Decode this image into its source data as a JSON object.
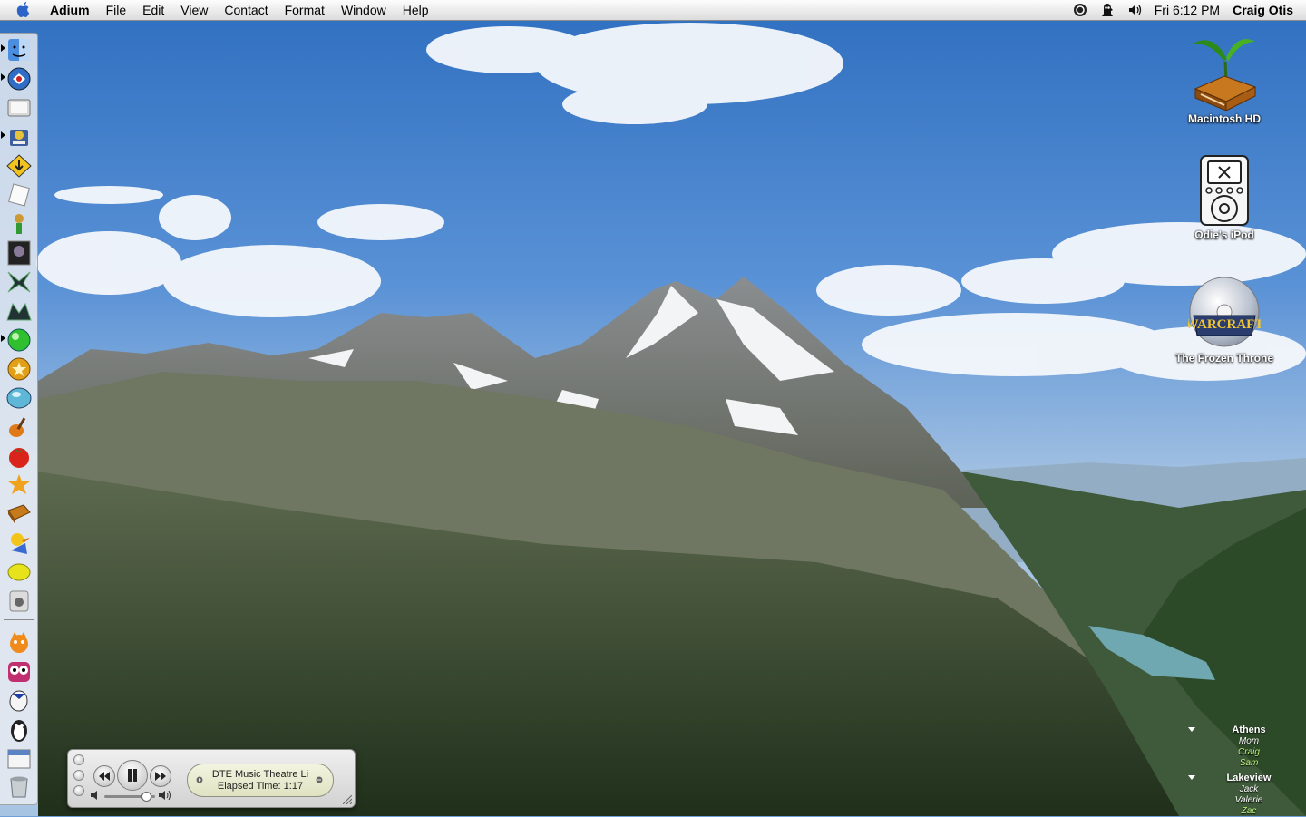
{
  "menubar": {
    "app_name": "Adium",
    "menus": [
      "File",
      "Edit",
      "View",
      "Contact",
      "Format",
      "Window",
      "Help"
    ],
    "clock": "Fri 6:12 PM",
    "user": "Craig Otis"
  },
  "desktop": {
    "icons": [
      {
        "label": "Macintosh HD"
      },
      {
        "label": "Odie's iPod"
      },
      {
        "label": "The Frozen Throne"
      }
    ]
  },
  "dock": {
    "apps": [
      "finder",
      "mail",
      "safari",
      "preferences",
      "news-reader",
      "editor",
      "jester",
      "game-a",
      "game-b",
      "game-c",
      "green-orb",
      "gold-orb",
      "blue-orb",
      "guitar",
      "tomato",
      "flower",
      "notebook",
      "duck",
      "lemon",
      "ipod",
      "cat",
      "owl",
      "chat-duck",
      "penguin",
      "calendar",
      "trash"
    ]
  },
  "itunes": {
    "track": "DTE Music Theatre   Li",
    "elapsed": "Elapsed Time: 1:17",
    "volume": 0.82
  },
  "buddy_list": {
    "groups": [
      {
        "name": "Athens",
        "buddies": [
          {
            "name": "Mom",
            "color": "#ffffff"
          },
          {
            "name": "Craig",
            "color": "#b9f27a"
          },
          {
            "name": "Sam",
            "color": "#b9f27a"
          }
        ]
      },
      {
        "name": "Lakeview",
        "buddies": [
          {
            "name": "Jack",
            "color": "#ffffff"
          },
          {
            "name": "Valerie",
            "color": "#ffffff"
          },
          {
            "name": "Zac",
            "color": "#b9f27a"
          }
        ]
      }
    ]
  }
}
